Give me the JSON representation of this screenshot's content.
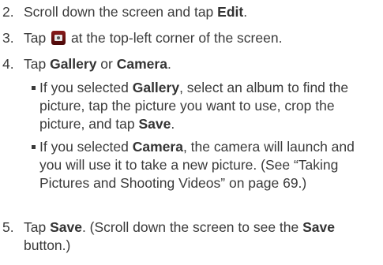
{
  "steps": [
    {
      "num": "2.",
      "pre": "Scroll down the screen and tap ",
      "bold": "Edit",
      "post": "."
    },
    {
      "num": "3.",
      "pre": "Tap ",
      "icon": "camera-icon",
      "post": " at the top-left corner of the screen."
    },
    {
      "num": "4.",
      "pre": "Tap ",
      "bold1": "Gallery",
      "mid": " or ",
      "bold2": "Camera",
      "post": "."
    },
    {
      "num": "5.",
      "pre": "Tap ",
      "bold1": "Save",
      "mid": ". (Scroll down the screen to see the ",
      "bold2": "Save",
      "post": "button.)"
    }
  ],
  "bullets": [
    {
      "pre": "If you selected ",
      "bold": "Gallery",
      "post": ", select an album to find the picture, tap the picture you want to use, crop the picture, and tap ",
      "bold2": "Save",
      "end": "."
    },
    {
      "pre": "If you selected ",
      "bold": "Camera",
      "post": ", the camera will launch and you will use it to take a new picture. (See “Taking Pictures and Shooting Videos” on page 69.)"
    }
  ],
  "colors": {
    "text": "#3a3a3a",
    "icon_bg": "#6b1212"
  }
}
